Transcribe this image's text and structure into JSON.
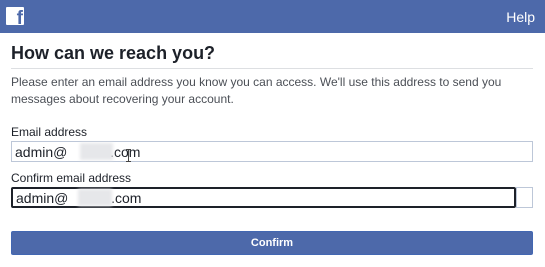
{
  "header": {
    "logo_icon": "facebook-f-icon",
    "logo_glyph": "f",
    "help_label": "Help",
    "bar_color": "#4d69aa"
  },
  "content": {
    "title": "How can we reach you?",
    "instructions": "Please enter an email address you know you can access. We'll use this address to send you messages about recovering your account."
  },
  "form": {
    "email_label": "Email address",
    "email_value": "admin@           .com",
    "confirm_label": "Confirm email address",
    "confirm_value": "admin@           .com",
    "confirm_button_label": "Confirm"
  }
}
